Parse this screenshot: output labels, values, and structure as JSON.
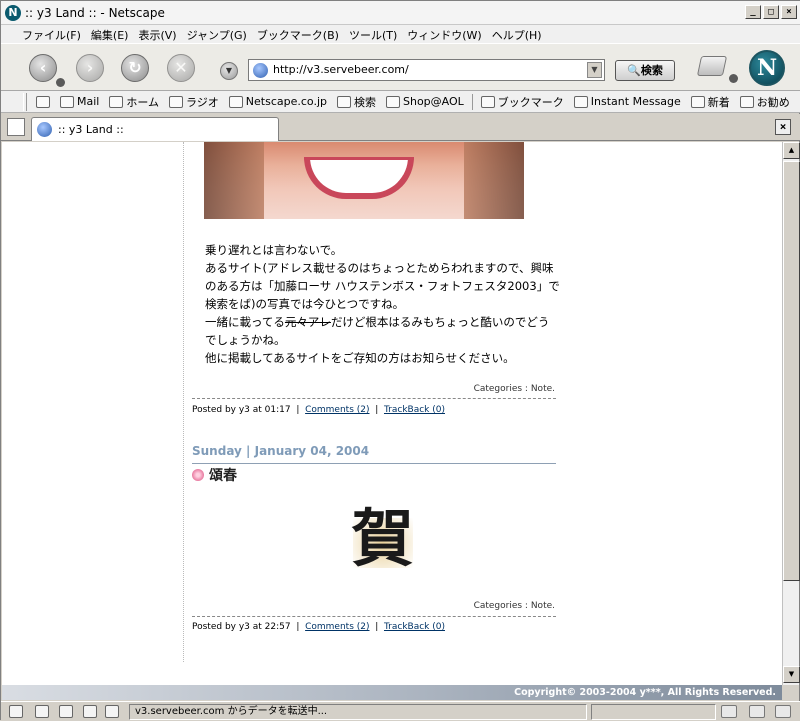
{
  "window": {
    "title": ":: y3 Land :: - Netscape"
  },
  "menu": {
    "items": [
      "ファイル(F)",
      "編集(E)",
      "表示(V)",
      "ジャンプ(G)",
      "ブックマーク(B)",
      "ツール(T)",
      "ウィンドウ(W)",
      "ヘルプ(H)"
    ]
  },
  "nav": {
    "url": "http://v3.servebeer.com/",
    "search_label": "検索"
  },
  "personal_toolbar": {
    "items": [
      "Mail",
      "ホーム",
      "ラジオ",
      "Netscape.co.jp",
      "検索",
      "Shop@AOL",
      "ブックマーク",
      "Instant Message",
      "新着",
      "お勧め"
    ]
  },
  "tabs": [
    {
      "label": ":: y3 Land ::"
    }
  ],
  "post1": {
    "lines": [
      "乗り遅れとは言わないで。",
      "あるサイト(アドレス載せるのはちょっとためらわれますので、興味",
      "のある方は「加藤ローサ ハウステンボス・フォトフェスタ2003」で",
      "検索をば)の写真では今ひとつですね。"
    ],
    "line5_pre": "一緒に載ってる",
    "line5_strike": "元々アレ",
    "line5_post": "だけど根本はるみもちょっと酷いのでどう",
    "line6": "でしょうかね。",
    "line7": "他に掲載してあるサイトをご存知の方はお知らせください。",
    "categories": "Categories : Note.",
    "posted": "Posted by y3 at 01:17",
    "comments": "Comments (2)",
    "trackback": "TrackBack (0)"
  },
  "post2": {
    "date": "Sunday | January 04, 2004",
    "title": "頌春",
    "kanji": "賀",
    "categories": "Categories : Note.",
    "posted": "Posted by y3 at 22:57",
    "comments": "Comments (2)",
    "trackback": "TrackBack (0)"
  },
  "footer": {
    "copyright": "Copyright© 2003-2004 y***, All Rights Reserved."
  },
  "status": {
    "message": "v3.servebeer.com からデータを転送中..."
  }
}
